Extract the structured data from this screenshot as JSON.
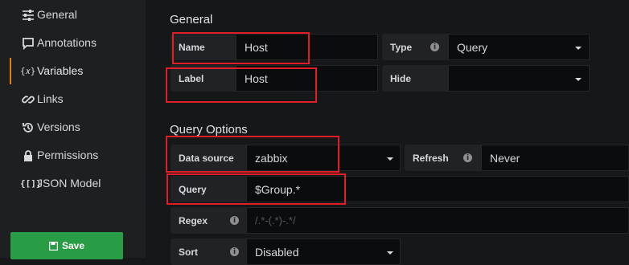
{
  "sidebar": {
    "items": [
      {
        "label": "General",
        "icon": "sliders-icon"
      },
      {
        "label": "Annotations",
        "icon": "comment-icon"
      },
      {
        "label": "Variables",
        "icon": "variable-icon"
      },
      {
        "label": "Links",
        "icon": "link-icon"
      },
      {
        "label": "Versions",
        "icon": "history-icon"
      },
      {
        "label": "Permissions",
        "icon": "lock-icon"
      },
      {
        "label": "JSON Model",
        "icon": "json-icon"
      }
    ],
    "active": "Variables",
    "save_label": "Save"
  },
  "general": {
    "title": "General",
    "name_label": "Name",
    "name_value": "Host",
    "type_label": "Type",
    "type_value": "Query",
    "label_label": "Label",
    "label_value": "Host",
    "hide_label": "Hide",
    "hide_value": ""
  },
  "query_options": {
    "title": "Query Options",
    "datasource_label": "Data source",
    "datasource_value": "zabbix",
    "refresh_label": "Refresh",
    "refresh_value": "Never",
    "query_label": "Query",
    "query_value": "$Group.*",
    "regex_label": "Regex",
    "regex_placeholder": "/.*-(.*)-.*/",
    "sort_label": "Sort",
    "sort_value": "Disabled"
  },
  "colors": {
    "accent": "#eb7b18",
    "save": "#299c46",
    "highlight": "#e11d26"
  }
}
